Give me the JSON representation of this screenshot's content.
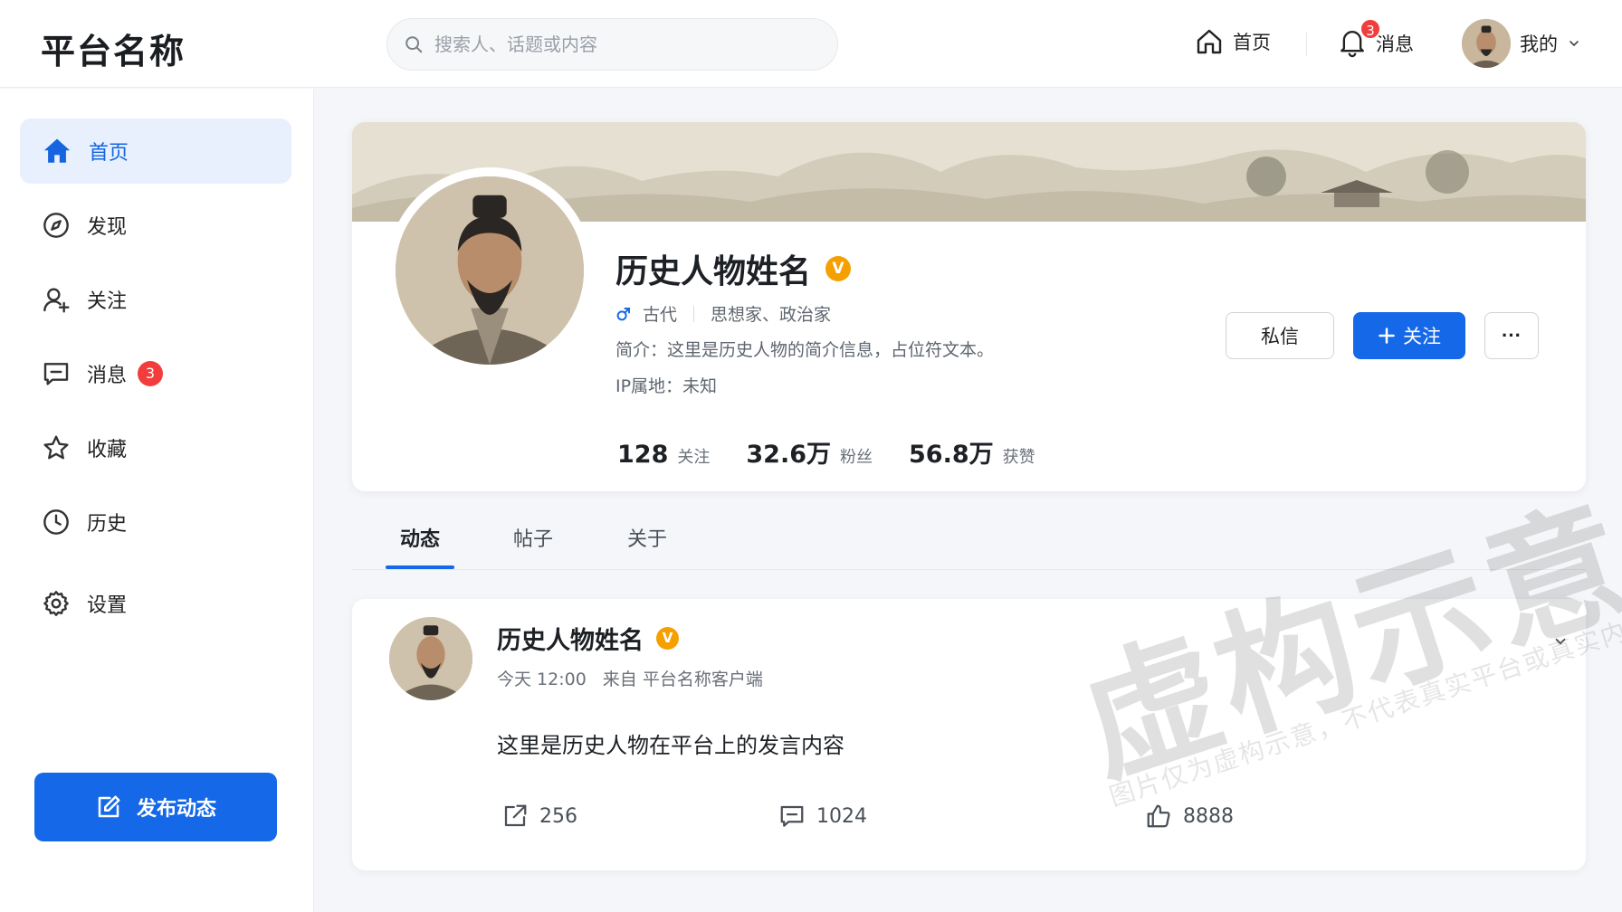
{
  "header": {
    "logo": "平台名称",
    "search_placeholder": "搜索人、话题或内容",
    "nav_home": "首页",
    "nav_messages": "消息",
    "nav_messages_badge": "3",
    "nav_me": "我的"
  },
  "sidebar": {
    "items": [
      {
        "label": "首页",
        "icon": "home-icon",
        "active": true
      },
      {
        "label": "发现",
        "icon": "compass-icon"
      },
      {
        "label": "关注",
        "icon": "user-plus-icon"
      },
      {
        "label": "消息",
        "icon": "message-icon",
        "badge": "3"
      },
      {
        "label": "收藏",
        "icon": "star-icon"
      },
      {
        "label": "历史",
        "icon": "clock-icon"
      },
      {
        "label": "设置",
        "icon": "gear-icon"
      }
    ],
    "publish_label": "发布动态"
  },
  "profile": {
    "name": "历史人物姓名",
    "verified_mark": "V",
    "era": "古代",
    "roles": "思想家、政治家",
    "bio": "简介：这里是历史人物的简介信息，占位符文本。",
    "ip": "IP属地：未知",
    "stats": [
      {
        "num": "128",
        "label": "关注"
      },
      {
        "num": "32.6万",
        "label": "粉丝"
      },
      {
        "num": "56.8万",
        "label": "获赞"
      }
    ],
    "btn_dm": "私信",
    "btn_follow": "关注",
    "btn_more": "···"
  },
  "tabs": [
    "动态",
    "帖子",
    "关于"
  ],
  "post": {
    "author": "历史人物姓名",
    "verified_mark": "V",
    "time": "今天 12:00",
    "source": "来自  平台名称客户端",
    "content": "这里是历史人物在平台上的发言内容",
    "shares": "256",
    "comments": "1024",
    "likes": "8888"
  },
  "watermark": {
    "big": "虚构示意",
    "small": "图片仅为虚构示意，不代表真实平台或真实内容"
  },
  "colors": {
    "accent": "#1569e8",
    "badge": "#f33c3c",
    "verified": "#f5a000"
  }
}
